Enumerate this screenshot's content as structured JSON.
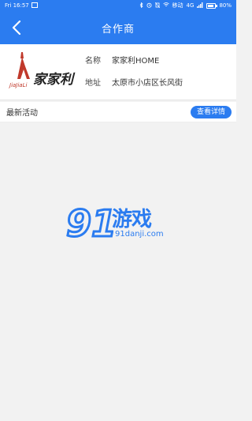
{
  "status_bar": {
    "time": "Fri 16:57",
    "network": "4G",
    "carrier": "移动",
    "battery": "80%",
    "battery_level": 0.8
  },
  "nav": {
    "title": "合作商",
    "back_icon": "chevron-left-icon"
  },
  "partner": {
    "logo_text": "家家利",
    "logo_sub": "JiaJiaLi",
    "name_label": "名称",
    "name_value": "家家利HOME",
    "address_label": "地址",
    "address_value": "太原市小店区长风街"
  },
  "activity": {
    "title": "最新活动",
    "details_button": "查看详情"
  },
  "watermark": {
    "brand_cn": "游戏",
    "domain": "91danji.com"
  },
  "colors": {
    "primary": "#2b7cf0",
    "background": "#f2f2f2",
    "card": "#ffffff",
    "logo_red": "#c0392b"
  }
}
